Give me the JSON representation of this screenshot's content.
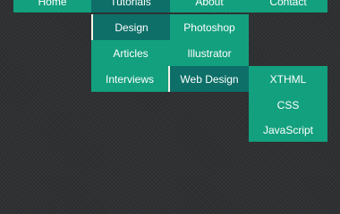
{
  "colors": {
    "menu_green": "#13a07e",
    "menu_active": "#0d6f68",
    "separator": "#f2f2e6",
    "text": "#ffffff",
    "background": "#2e3032"
  },
  "top_nav": {
    "home": "Home",
    "tutorials": "Tutorials",
    "about": "About",
    "contact": "Contact"
  },
  "tutorials_menu": {
    "design": "Design",
    "articles": "Articles",
    "interviews": "Interviews"
  },
  "design_menu": {
    "photoshop": "Photoshop",
    "illustrator": "Illustrator",
    "web_design": "Web Design"
  },
  "web_design_menu": {
    "xthml": "XTHML",
    "css": "CSS",
    "javascript": "JavaScript"
  }
}
